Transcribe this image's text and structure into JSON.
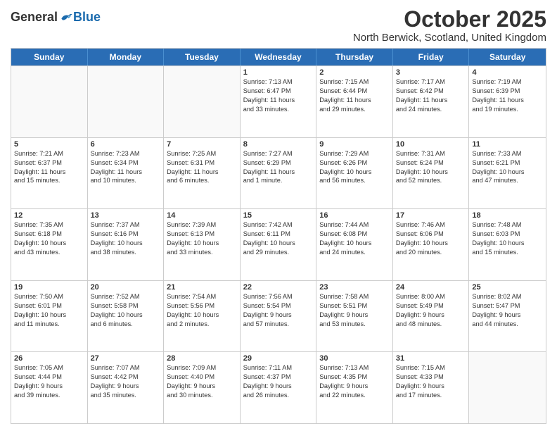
{
  "logo": {
    "general": "General",
    "blue": "Blue"
  },
  "header": {
    "month": "October 2025",
    "location": "North Berwick, Scotland, United Kingdom"
  },
  "days_of_week": [
    "Sunday",
    "Monday",
    "Tuesday",
    "Wednesday",
    "Thursday",
    "Friday",
    "Saturday"
  ],
  "weeks": [
    [
      {
        "day": "",
        "info": "",
        "empty": true
      },
      {
        "day": "",
        "info": "",
        "empty": true
      },
      {
        "day": "",
        "info": "",
        "empty": true
      },
      {
        "day": "1",
        "info": "Sunrise: 7:13 AM\nSunset: 6:47 PM\nDaylight: 11 hours\nand 33 minutes.",
        "empty": false
      },
      {
        "day": "2",
        "info": "Sunrise: 7:15 AM\nSunset: 6:44 PM\nDaylight: 11 hours\nand 29 minutes.",
        "empty": false
      },
      {
        "day": "3",
        "info": "Sunrise: 7:17 AM\nSunset: 6:42 PM\nDaylight: 11 hours\nand 24 minutes.",
        "empty": false
      },
      {
        "day": "4",
        "info": "Sunrise: 7:19 AM\nSunset: 6:39 PM\nDaylight: 11 hours\nand 19 minutes.",
        "empty": false
      }
    ],
    [
      {
        "day": "5",
        "info": "Sunrise: 7:21 AM\nSunset: 6:37 PM\nDaylight: 11 hours\nand 15 minutes.",
        "empty": false
      },
      {
        "day": "6",
        "info": "Sunrise: 7:23 AM\nSunset: 6:34 PM\nDaylight: 11 hours\nand 10 minutes.",
        "empty": false
      },
      {
        "day": "7",
        "info": "Sunrise: 7:25 AM\nSunset: 6:31 PM\nDaylight: 11 hours\nand 6 minutes.",
        "empty": false
      },
      {
        "day": "8",
        "info": "Sunrise: 7:27 AM\nSunset: 6:29 PM\nDaylight: 11 hours\nand 1 minute.",
        "empty": false
      },
      {
        "day": "9",
        "info": "Sunrise: 7:29 AM\nSunset: 6:26 PM\nDaylight: 10 hours\nand 56 minutes.",
        "empty": false
      },
      {
        "day": "10",
        "info": "Sunrise: 7:31 AM\nSunset: 6:24 PM\nDaylight: 10 hours\nand 52 minutes.",
        "empty": false
      },
      {
        "day": "11",
        "info": "Sunrise: 7:33 AM\nSunset: 6:21 PM\nDaylight: 10 hours\nand 47 minutes.",
        "empty": false
      }
    ],
    [
      {
        "day": "12",
        "info": "Sunrise: 7:35 AM\nSunset: 6:18 PM\nDaylight: 10 hours\nand 43 minutes.",
        "empty": false
      },
      {
        "day": "13",
        "info": "Sunrise: 7:37 AM\nSunset: 6:16 PM\nDaylight: 10 hours\nand 38 minutes.",
        "empty": false
      },
      {
        "day": "14",
        "info": "Sunrise: 7:39 AM\nSunset: 6:13 PM\nDaylight: 10 hours\nand 33 minutes.",
        "empty": false
      },
      {
        "day": "15",
        "info": "Sunrise: 7:42 AM\nSunset: 6:11 PM\nDaylight: 10 hours\nand 29 minutes.",
        "empty": false
      },
      {
        "day": "16",
        "info": "Sunrise: 7:44 AM\nSunset: 6:08 PM\nDaylight: 10 hours\nand 24 minutes.",
        "empty": false
      },
      {
        "day": "17",
        "info": "Sunrise: 7:46 AM\nSunset: 6:06 PM\nDaylight: 10 hours\nand 20 minutes.",
        "empty": false
      },
      {
        "day": "18",
        "info": "Sunrise: 7:48 AM\nSunset: 6:03 PM\nDaylight: 10 hours\nand 15 minutes.",
        "empty": false
      }
    ],
    [
      {
        "day": "19",
        "info": "Sunrise: 7:50 AM\nSunset: 6:01 PM\nDaylight: 10 hours\nand 11 minutes.",
        "empty": false
      },
      {
        "day": "20",
        "info": "Sunrise: 7:52 AM\nSunset: 5:58 PM\nDaylight: 10 hours\nand 6 minutes.",
        "empty": false
      },
      {
        "day": "21",
        "info": "Sunrise: 7:54 AM\nSunset: 5:56 PM\nDaylight: 10 hours\nand 2 minutes.",
        "empty": false
      },
      {
        "day": "22",
        "info": "Sunrise: 7:56 AM\nSunset: 5:54 PM\nDaylight: 9 hours\nand 57 minutes.",
        "empty": false
      },
      {
        "day": "23",
        "info": "Sunrise: 7:58 AM\nSunset: 5:51 PM\nDaylight: 9 hours\nand 53 minutes.",
        "empty": false
      },
      {
        "day": "24",
        "info": "Sunrise: 8:00 AM\nSunset: 5:49 PM\nDaylight: 9 hours\nand 48 minutes.",
        "empty": false
      },
      {
        "day": "25",
        "info": "Sunrise: 8:02 AM\nSunset: 5:47 PM\nDaylight: 9 hours\nand 44 minutes.",
        "empty": false
      }
    ],
    [
      {
        "day": "26",
        "info": "Sunrise: 7:05 AM\nSunset: 4:44 PM\nDaylight: 9 hours\nand 39 minutes.",
        "empty": false
      },
      {
        "day": "27",
        "info": "Sunrise: 7:07 AM\nSunset: 4:42 PM\nDaylight: 9 hours\nand 35 minutes.",
        "empty": false
      },
      {
        "day": "28",
        "info": "Sunrise: 7:09 AM\nSunset: 4:40 PM\nDaylight: 9 hours\nand 30 minutes.",
        "empty": false
      },
      {
        "day": "29",
        "info": "Sunrise: 7:11 AM\nSunset: 4:37 PM\nDaylight: 9 hours\nand 26 minutes.",
        "empty": false
      },
      {
        "day": "30",
        "info": "Sunrise: 7:13 AM\nSunset: 4:35 PM\nDaylight: 9 hours\nand 22 minutes.",
        "empty": false
      },
      {
        "day": "31",
        "info": "Sunrise: 7:15 AM\nSunset: 4:33 PM\nDaylight: 9 hours\nand 17 minutes.",
        "empty": false
      },
      {
        "day": "",
        "info": "",
        "empty": true
      }
    ]
  ]
}
